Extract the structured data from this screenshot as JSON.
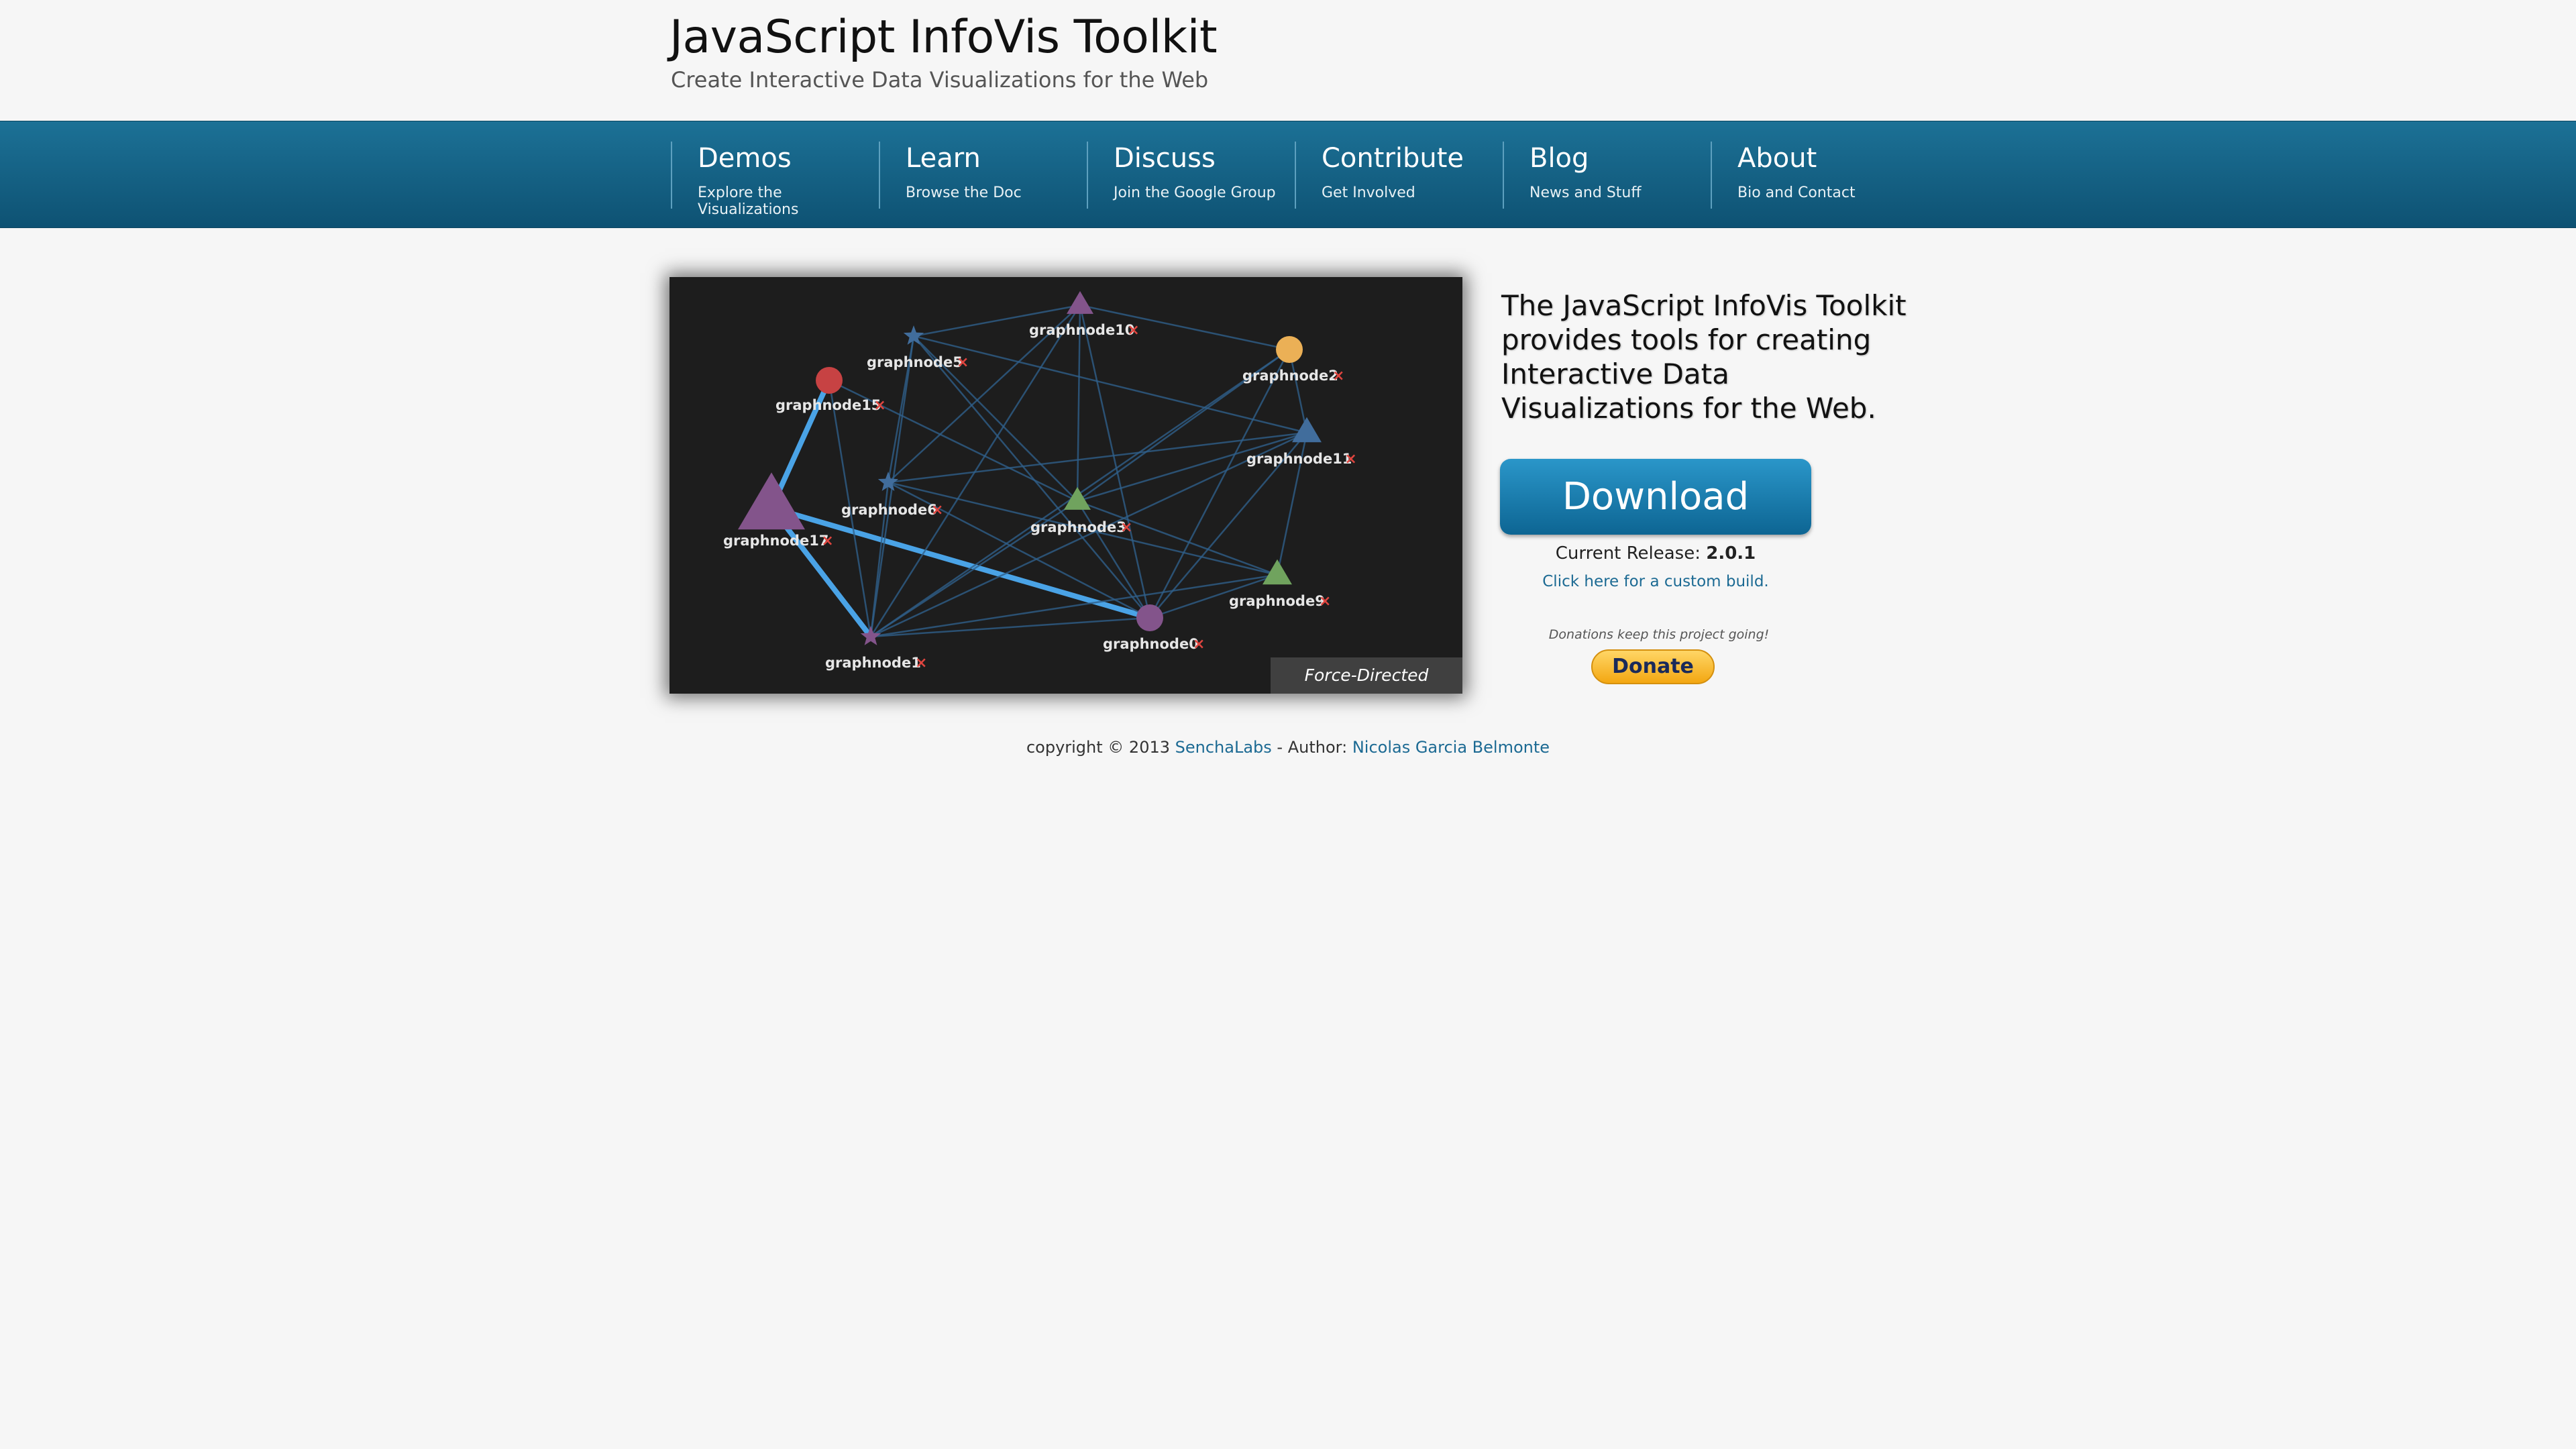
{
  "header": {
    "title": "JavaScript InfoVis Toolkit",
    "tagline": "Create Interactive Data Visualizations for the Web"
  },
  "nav": [
    {
      "label": "Demos",
      "sub": "Explore the Visualizations"
    },
    {
      "label": "Learn",
      "sub": "Browse the Doc"
    },
    {
      "label": "Discuss",
      "sub": "Join the Google Group"
    },
    {
      "label": "Contribute",
      "sub": "Get Involved"
    },
    {
      "label": "Blog",
      "sub": "News and Stuff"
    },
    {
      "label": "About",
      "sub": "Bio and Contact"
    }
  ],
  "demo": {
    "caption": "Force-Directed Layouts",
    "nodes": [
      {
        "id": "graphnode10",
        "shape": "triangle",
        "color": "#83548b"
      },
      {
        "id": "graphnode5",
        "shape": "star",
        "color": "#416d9c"
      },
      {
        "id": "graphnode2",
        "shape": "circle",
        "color": "#ebb056"
      },
      {
        "id": "graphnode15",
        "shape": "circle",
        "color": "#c74243"
      },
      {
        "id": "graphnode11",
        "shape": "triangle",
        "color": "#416d9c"
      },
      {
        "id": "graphnode6",
        "shape": "star",
        "color": "#416d9c"
      },
      {
        "id": "graphnode3",
        "shape": "triangle",
        "color": "#70a35e"
      },
      {
        "id": "graphnode17",
        "shape": "triangle",
        "color": "#83548b"
      },
      {
        "id": "graphnode9",
        "shape": "triangle",
        "color": "#70a35e"
      },
      {
        "id": "graphnode0",
        "shape": "circle",
        "color": "#83548b"
      },
      {
        "id": "graphnode1",
        "shape": "star",
        "color": "#83548b"
      }
    ],
    "edges": [
      [
        "graphnode17",
        "graphnode15"
      ],
      [
        "graphnode17",
        "graphnode1"
      ],
      [
        "graphnode17",
        "graphnode0"
      ],
      [
        "graphnode10",
        "graphnode5"
      ],
      [
        "graphnode10",
        "graphnode2"
      ],
      [
        "graphnode10",
        "graphnode3"
      ],
      [
        "graphnode10",
        "graphnode6"
      ],
      [
        "graphnode10",
        "graphnode1"
      ],
      [
        "graphnode10",
        "graphnode0"
      ],
      [
        "graphnode5",
        "graphnode3"
      ],
      [
        "graphnode5",
        "graphnode6"
      ],
      [
        "graphnode5",
        "graphnode0"
      ],
      [
        "graphnode5",
        "graphnode11"
      ],
      [
        "graphnode2",
        "graphnode3"
      ],
      [
        "graphnode2",
        "graphnode1"
      ],
      [
        "graphnode2",
        "graphnode0"
      ],
      [
        "graphnode2",
        "graphnode11"
      ],
      [
        "graphnode15",
        "graphnode3"
      ],
      [
        "graphnode15",
        "graphnode1"
      ],
      [
        "graphnode6",
        "graphnode11"
      ],
      [
        "graphnode6",
        "graphnode1"
      ],
      [
        "graphnode6",
        "graphnode0"
      ],
      [
        "graphnode6",
        "graphnode9"
      ],
      [
        "graphnode3",
        "graphnode0"
      ],
      [
        "graphnode3",
        "graphnode1"
      ],
      [
        "graphnode3",
        "graphnode11"
      ],
      [
        "graphnode3",
        "graphnode9"
      ],
      [
        "graphnode11",
        "graphnode9"
      ],
      [
        "graphnode11",
        "graphnode1"
      ],
      [
        "graphnode11",
        "graphnode0"
      ],
      [
        "graphnode9",
        "graphnode1"
      ],
      [
        "graphnode9",
        "graphnode0"
      ],
      [
        "graphnode0",
        "graphnode1"
      ],
      [
        "graphnode1",
        "graphnode5"
      ]
    ],
    "highlighted_edges": [
      [
        "graphnode17",
        "graphnode15"
      ],
      [
        "graphnode17",
        "graphnode1"
      ],
      [
        "graphnode17",
        "graphnode0"
      ]
    ],
    "remove_glyph": "×"
  },
  "intro": "The JavaScript InfoVis Toolkit provides tools for creating Interactive Data Visualizations for the Web.",
  "download": {
    "label": "Download",
    "release_label": "Current Release:",
    "release_version": "2.0.1",
    "custom_build": "Click here for a custom build."
  },
  "donate": {
    "note": "Donations keep this project going!",
    "label": "Donate"
  },
  "footer": {
    "copyright": "copyright © 2013",
    "company": "SenchaLabs",
    "author_label": "- Author:",
    "author": "Nicolas Garcia Belmonte"
  }
}
